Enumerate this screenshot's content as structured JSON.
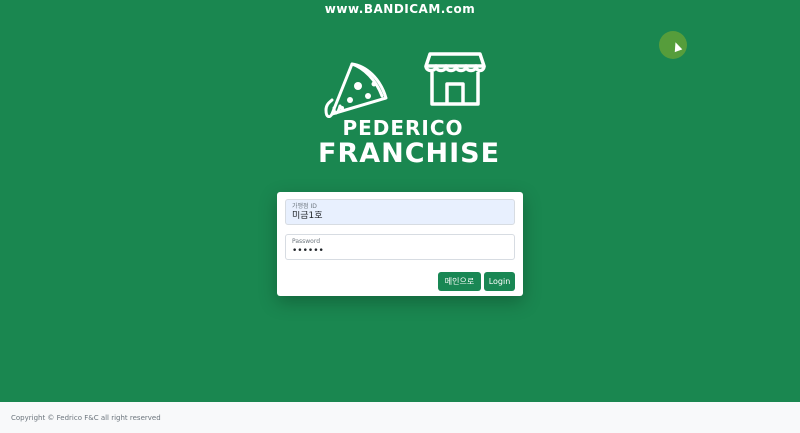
{
  "watermark": "www.BANDICAM.com",
  "brand": {
    "line1": "PEDERICO",
    "line2": "FRANCHISE"
  },
  "login_form": {
    "id_field": {
      "label": "가맹점 ID",
      "value": "미금1호"
    },
    "password_field": {
      "label": "Password",
      "value": "••••••"
    },
    "main_button_label": "메인으로",
    "login_button_label": "Login"
  },
  "footer": {
    "copyright": "Copyright © Fedrico F&C all right reserved"
  },
  "colors": {
    "background": "#1a8750",
    "accent": "#198754",
    "autofill": "#e8f0fe"
  },
  "icons": [
    "pizza-icon",
    "store-icon"
  ]
}
